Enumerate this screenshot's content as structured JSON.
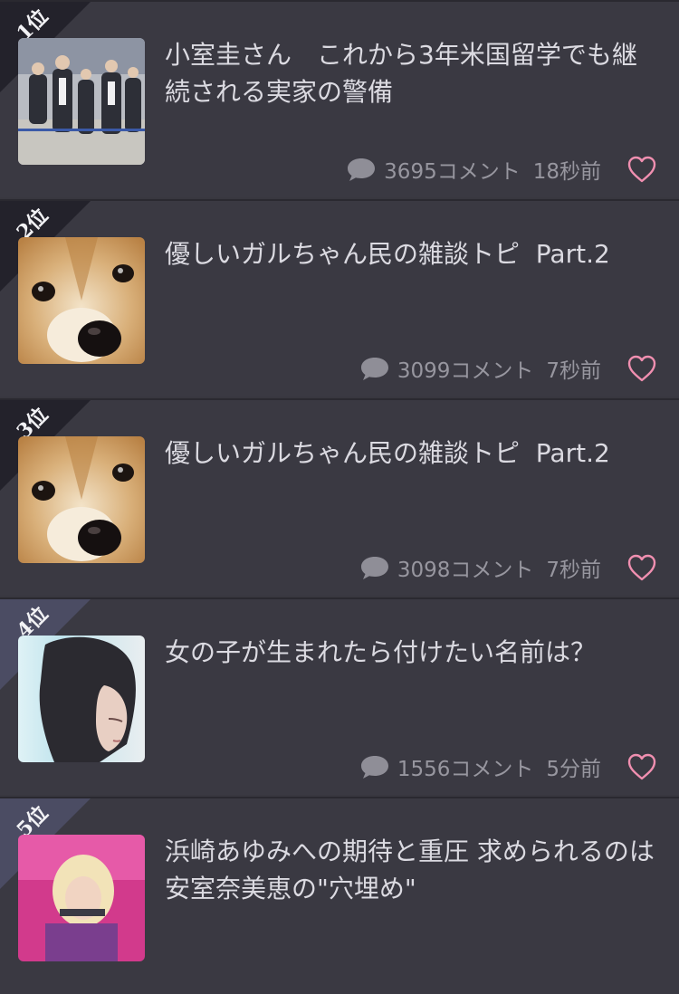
{
  "topics": [
    {
      "rank_label": "1位",
      "title": "小室圭さん　これから3年米国留学でも継続される実家の警備",
      "comments": "3695コメント",
      "time": "18秒前",
      "thumbnail": "crowd-photo"
    },
    {
      "rank_label": "2位",
      "title": "優しいガルちゃん民の雑談トピ  Part.2",
      "comments": "3099コメント",
      "time": "7秒前",
      "thumbnail": "dog-face-photo"
    },
    {
      "rank_label": "3位",
      "title": "優しいガルちゃん民の雑談トピ  Part.2",
      "comments": "3098コメント",
      "time": "7秒前",
      "thumbnail": "dog-face-photo"
    },
    {
      "rank_label": "4位",
      "title": "女の子が生まれたら付けたい名前は？",
      "comments": "1556コメント",
      "time": "5分前",
      "thumbnail": "woman-portrait-photo"
    },
    {
      "rank_label": "5位",
      "title": "浜崎あゆみへの期待と重圧 求められるのは安室奈美恵の\"穴埋め\"",
      "comments": "",
      "time": "",
      "thumbnail": "singer-photo"
    }
  ],
  "icons": {
    "comment": "speech-bubble-icon",
    "favorite": "heart-outline-icon"
  },
  "colors": {
    "background": "#38373f",
    "ribbon_dark": "#23222b",
    "ribbon_light": "#4b4c63",
    "heart": "#f08fb0",
    "meta_text": "#97969f"
  }
}
